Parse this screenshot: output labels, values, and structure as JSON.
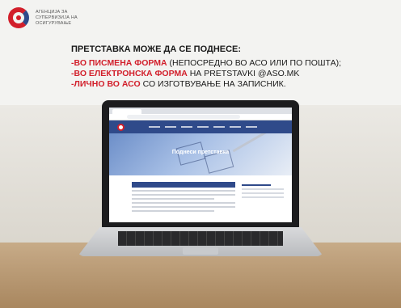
{
  "brand": {
    "name_line1": "АГЕНЦИЈА ЗА",
    "name_line2": "СУПЕРВИЗИЈА НА",
    "name_line3": "ОСИГУРУВАЊЕ",
    "colors": {
      "red": "#d21f2b",
      "blue": "#2f4a8a"
    }
  },
  "notice": {
    "heading": "ПРЕТСТАВКА МОЖЕ ДА СЕ ПОДНЕСЕ:",
    "lines": [
      {
        "highlight": "-ВО ПИСМЕНА ФОРМА",
        "rest": " (НЕПОСРЕДНО ВО АСО ИЛИ ПО ПОШТА);"
      },
      {
        "highlight": "-ВО ЕЛЕКТРОНСКА ФОРМА",
        "rest": " НА PRETSTAVKI @ASO.MK"
      },
      {
        "highlight": "-ЛИЧНО ВО АСО",
        "rest": " СО ИЗГОТВУВАЊЕ НА ЗАПИСНИК."
      }
    ]
  },
  "laptop_screen": {
    "hero_title": "Поднеси претставка"
  }
}
